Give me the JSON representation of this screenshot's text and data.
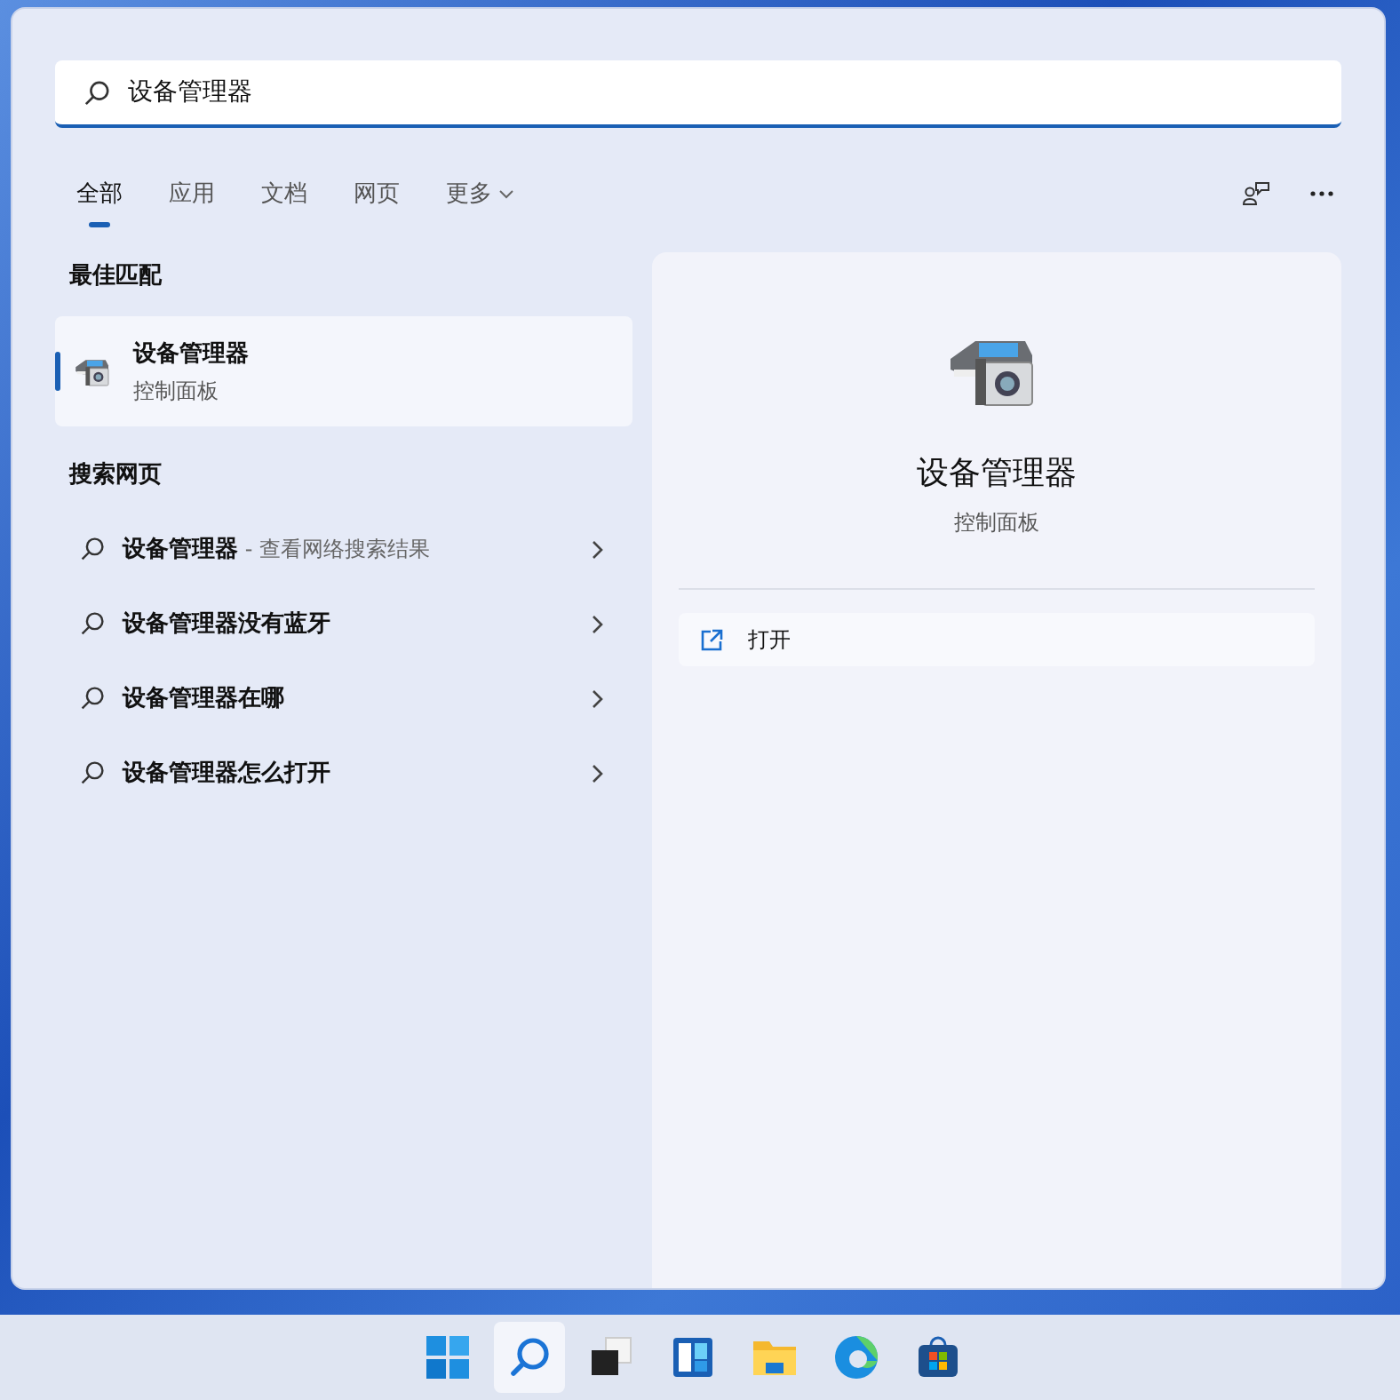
{
  "search": {
    "value": "设备管理器"
  },
  "tabs": [
    {
      "label": "全部",
      "selected": true
    },
    {
      "label": "应用",
      "selected": false
    },
    {
      "label": "文档",
      "selected": false
    },
    {
      "label": "网页",
      "selected": false
    },
    {
      "label": "更多",
      "selected": false,
      "dropdown": true
    }
  ],
  "best_match": {
    "heading": "最佳匹配",
    "item": {
      "title": "设备管理器",
      "subtitle": "控制面板",
      "selected": true
    }
  },
  "web_search": {
    "heading": "搜索网页",
    "items": [
      {
        "title": "设备管理器",
        "suffix": " - 查看网络搜索结果"
      },
      {
        "title": "设备管理器没有蓝牙"
      },
      {
        "title": "设备管理器在哪"
      },
      {
        "title": "设备管理器怎么打开"
      }
    ]
  },
  "detail": {
    "title": "设备管理器",
    "subtitle": "控制面板",
    "actions": [
      {
        "label": "打开"
      }
    ]
  },
  "taskbar": {
    "items": [
      {
        "kind": "start",
        "selected": false
      },
      {
        "kind": "search",
        "selected": true
      },
      {
        "kind": "taskview",
        "selected": false
      },
      {
        "kind": "widgets",
        "selected": false
      },
      {
        "kind": "explorer",
        "selected": false
      },
      {
        "kind": "edge",
        "selected": false
      },
      {
        "kind": "store",
        "selected": false
      }
    ]
  }
}
